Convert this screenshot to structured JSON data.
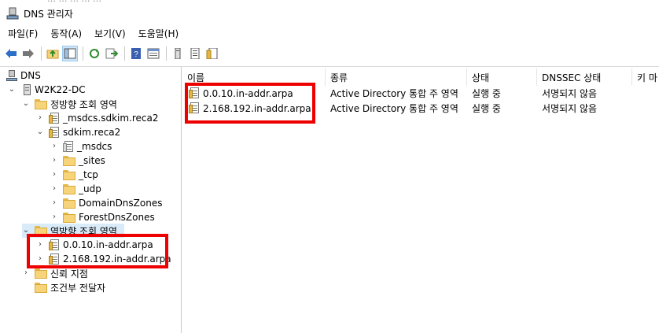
{
  "window": {
    "title": "DNS 관리자",
    "top_fragment": "… … … … …"
  },
  "menu": [
    "파일(F)",
    "동작(A)",
    "보기(V)",
    "도움말(H)"
  ],
  "toolbar": {
    "buttons": [
      "back-icon",
      "forward-icon",
      "up-folder-icon",
      "show-tree-icon",
      "refresh-icon",
      "export-icon",
      "help-icon",
      "properties-icon",
      "server-icon",
      "zone-list-icon",
      "new-zone-icon"
    ]
  },
  "tree": {
    "root": "DNS",
    "server": "W2K22-DC",
    "forward_zone": "정방향 조회 영역",
    "forward_children": [
      "_msdcs.sdkim.reca2",
      "sdkim.reca2"
    ],
    "sdkim_children": [
      "_msdcs",
      "_sites",
      "_tcp",
      "_udp",
      "DomainDnsZones",
      "ForestDnsZones"
    ],
    "reverse_zone": "역방향 조회 영역",
    "reverse_children": [
      "0.0.10.in-addr.arpa",
      "2.168.192.in-addr.arpa"
    ],
    "trust_points": "신뢰 지점",
    "conditional_forwarders": "조건부 전달자"
  },
  "list": {
    "columns": [
      "이름",
      "종류",
      "상태",
      "DNSSEC 상태",
      "키 마"
    ],
    "rows": [
      {
        "name": "0.0.10.in-addr.arpa",
        "type": "Active Directory 통합 주 영역",
        "status": "실행 중",
        "dnssec": "서명되지 않음"
      },
      {
        "name": "2.168.192.in-addr.arpa",
        "type": "Active Directory 통합 주 영역",
        "status": "실행 중",
        "dnssec": "서명되지 않음"
      }
    ]
  },
  "colors": {
    "highlight_box": "#ee0000",
    "selection": "#d9ebf9"
  }
}
